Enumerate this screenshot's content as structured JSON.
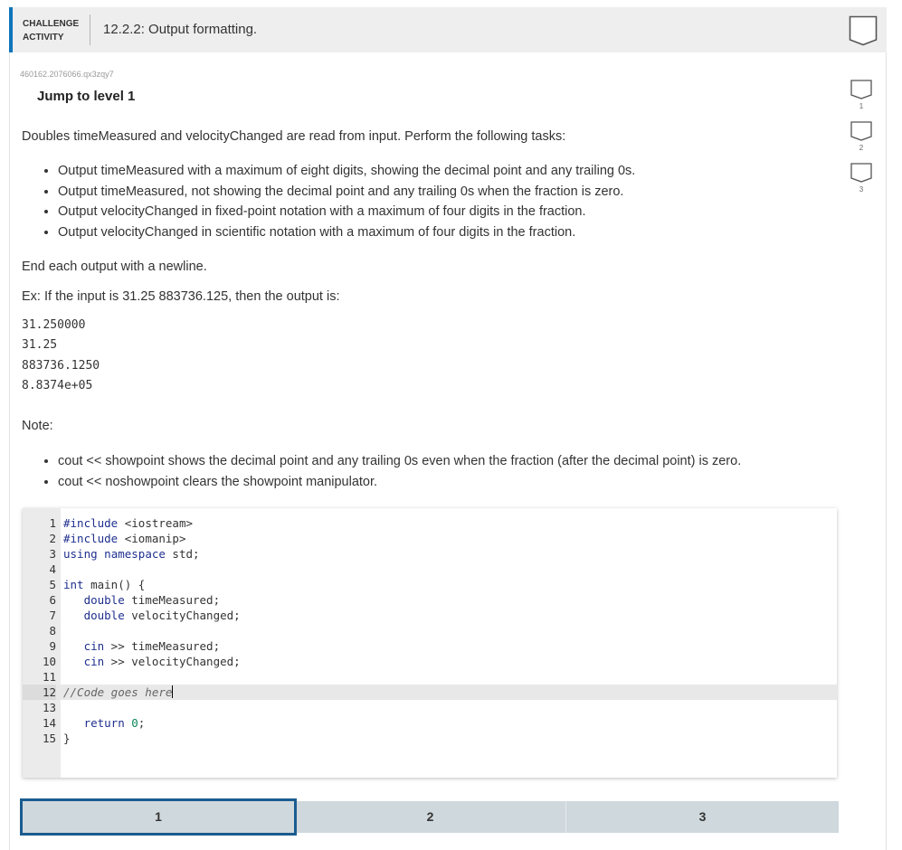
{
  "header": {
    "category_line1": "CHALLENGE",
    "category_line2": "ACTIVITY",
    "title": "12.2.2: Output formatting."
  },
  "activity_id": "460162.2076066.qx3zqy7",
  "jump_label": "Jump to level 1",
  "side_levels": [
    "1",
    "2",
    "3"
  ],
  "intro": "Doubles timeMeasured and velocityChanged are read from input. Perform the following tasks:",
  "tasks": [
    "Output timeMeasured with a maximum of eight digits, showing the decimal point and any trailing 0s.",
    "Output timeMeasured, not showing the decimal point and any trailing 0s when the fraction is zero.",
    "Output velocityChanged in fixed-point notation with a maximum of four digits in the fraction.",
    "Output velocityChanged in scientific notation with a maximum of four digits in the fraction."
  ],
  "end_note": "End each output with a newline.",
  "example_intro": "Ex: If the input is 31.25 883736.125, then the output is:",
  "example_output": [
    "31.250000",
    "31.25",
    "883736.1250",
    "8.8374e+05"
  ],
  "note_label": "Note:",
  "notes": [
    "cout << showpoint shows the decimal point and any trailing 0s even when the fraction (after the decimal point) is zero.",
    "cout << noshowpoint clears the showpoint manipulator."
  ],
  "code": [
    {
      "n": "1",
      "text": "#include <iostream>"
    },
    {
      "n": "2",
      "text": "#include <iomanip>"
    },
    {
      "n": "3",
      "text": "using namespace std;"
    },
    {
      "n": "4",
      "text": ""
    },
    {
      "n": "5",
      "text": "int main() {"
    },
    {
      "n": "6",
      "text": "   double timeMeasured;"
    },
    {
      "n": "7",
      "text": "   double velocityChanged;"
    },
    {
      "n": "8",
      "text": ""
    },
    {
      "n": "9",
      "text": "   cin >> timeMeasured;"
    },
    {
      "n": "10",
      "text": "   cin >> velocityChanged;"
    },
    {
      "n": "11",
      "text": ""
    },
    {
      "n": "12",
      "text": "//Code goes here"
    },
    {
      "n": "13",
      "text": ""
    },
    {
      "n": "14",
      "text": "   return 0;"
    },
    {
      "n": "15",
      "text": "}"
    }
  ],
  "level_tabs": [
    "1",
    "2",
    "3"
  ],
  "colors": {
    "accent": "#0f75bc",
    "level_bar": "#cfd8dc",
    "selected_border": "#1b5c8f"
  }
}
